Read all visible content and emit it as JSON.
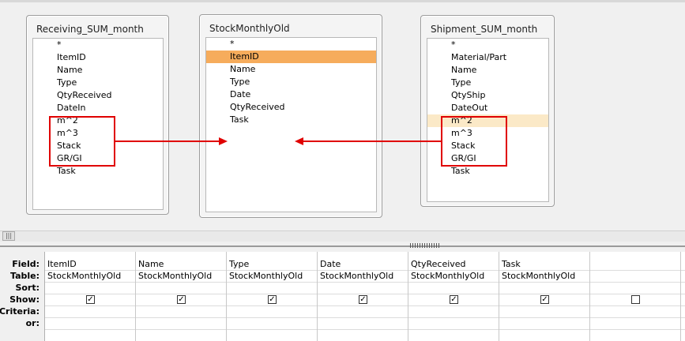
{
  "tables": [
    {
      "title": "Receiving_SUM_month",
      "fields": [
        "*",
        "ItemID",
        "Name",
        "Type",
        "QtyReceived",
        "DateIn",
        "m^2",
        "m^3",
        "Stack",
        "GR/GI",
        "Task"
      ]
    },
    {
      "title": "StockMonthlyOld",
      "fields": [
        "*",
        "ItemID",
        "Name",
        "Type",
        "Date",
        "QtyReceived",
        "Task"
      ],
      "selected_field": "ItemID"
    },
    {
      "title": "Shipment_SUM_month",
      "fields": [
        "*",
        "Material/Part",
        "Name",
        "Type",
        "QtyShip",
        "DateOut",
        "m^2",
        "m^3",
        "Stack",
        "GR/GI",
        "Task"
      ],
      "highlighted_field": "m^2"
    }
  ],
  "annotation_color": "#e00000",
  "grid": {
    "row_labels": [
      "Field:",
      "Table:",
      "Sort:",
      "Show:",
      "Criteria:",
      "or:"
    ],
    "columns": [
      {
        "field": "ItemID",
        "table": "StockMonthlyOld",
        "show": true
      },
      {
        "field": "Name",
        "table": "StockMonthlyOld",
        "show": true
      },
      {
        "field": "Type",
        "table": "StockMonthlyOld",
        "show": true
      },
      {
        "field": "Date",
        "table": "StockMonthlyOld",
        "show": true
      },
      {
        "field": "QtyReceived",
        "table": "StockMonthlyOld",
        "show": true
      },
      {
        "field": "Task",
        "table": "StockMonthlyOld",
        "show": true
      },
      {
        "field": "",
        "table": "",
        "show": false
      }
    ]
  }
}
